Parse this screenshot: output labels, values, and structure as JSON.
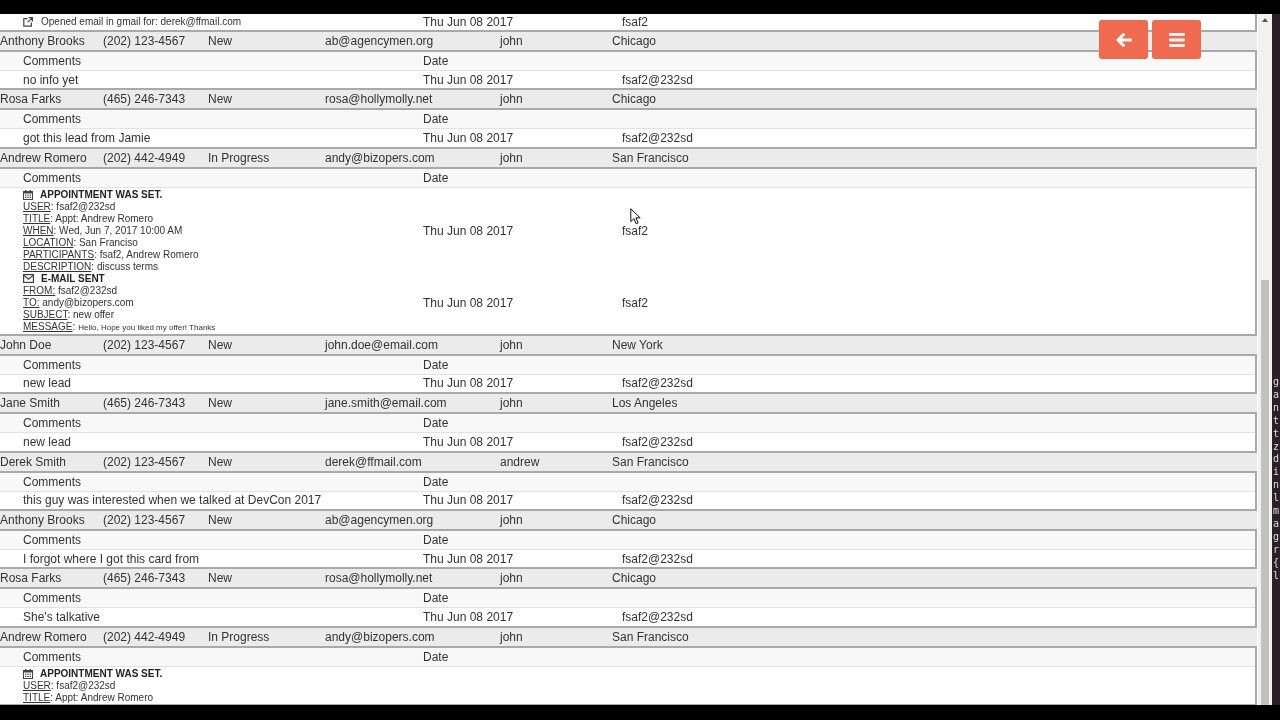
{
  "previous_lead_entries": [
    {
      "kind": "activity",
      "text": "Opened email in gmail for: derek@ffmail.com",
      "date": "Thu Jun 08 2017",
      "user": "fsaf2"
    }
  ],
  "leads": [
    {
      "name": "Anthony Brooks",
      "phone": "(202) 123-4567",
      "status": "New",
      "email": "ab@agencymen.org",
      "owner": "john",
      "city": "Chicago",
      "comments_header": "Comments",
      "date_header": "Date",
      "entries": [
        {
          "kind": "note",
          "text": "no info yet",
          "date": "Thu Jun 08 2017",
          "user": "fsaf2@232sd"
        }
      ]
    },
    {
      "name": "Rosa Farks",
      "phone": "(465) 246-7343",
      "status": "New",
      "email": "rosa@hollymolly.net",
      "owner": "john",
      "city": "Chicago",
      "comments_header": "Comments",
      "date_header": "Date",
      "entries": [
        {
          "kind": "note",
          "text": "got this lead from Jamie",
          "date": "Thu Jun 08 2017",
          "user": "fsaf2@232sd"
        }
      ]
    },
    {
      "name": "Andrew Romero",
      "phone": "(202) 442-4949",
      "status": "In Progress",
      "email": "andy@bizopers.com",
      "owner": "john",
      "city": "San Francisco",
      "comments_header": "Comments",
      "date_header": "Date",
      "entries": [
        {
          "kind": "appointment",
          "title": "APPOINTMENT WAS SET.",
          "fields": [
            {
              "label": "USER",
              "value": ": fsaf2@232sd"
            },
            {
              "label": "TITLE",
              "value": ": Appt: Andrew Romero"
            },
            {
              "label": "WHEN",
              "value": ": Wed, Jun 7, 2017 10:00 AM"
            },
            {
              "label": "LOCATION",
              "value": ": San Franciso"
            },
            {
              "label": "PARTICIPANTS",
              "value": ": fsaf2, Andrew Romero"
            },
            {
              "label": "DESCRIPTION",
              "value": ": discuss terms"
            }
          ],
          "date": "Thu Jun 08 2017",
          "user": "fsaf2"
        },
        {
          "kind": "email",
          "title": "E-MAIL SENT",
          "fields": [
            {
              "label": "FROM:",
              "value": " fsaf2@232sd"
            },
            {
              "label": "TO:",
              "value": " andy@bizopers.com"
            },
            {
              "label": "SUBJECT",
              "value": ": new offer"
            },
            {
              "label": "MESSAGE",
              "value": ":",
              "fine_print": "Hello, Hope you liked my offer! Thanks"
            }
          ],
          "date": "Thu Jun 08 2017",
          "user": "fsaf2"
        }
      ]
    },
    {
      "name": "John Doe",
      "phone": "(202) 123-4567",
      "status": "New",
      "email": "john.doe@email.com",
      "owner": "john",
      "city": "New York",
      "comments_header": "Comments",
      "date_header": "Date",
      "entries": [
        {
          "kind": "note",
          "text": "new lead",
          "date": "Thu Jun 08 2017",
          "user": "fsaf2@232sd"
        }
      ]
    },
    {
      "name": "Jane Smith",
      "phone": "(465) 246-7343",
      "status": "New",
      "email": "jane.smith@email.com",
      "owner": "john",
      "city": "Los Angeles",
      "comments_header": "Comments",
      "date_header": "Date",
      "entries": [
        {
          "kind": "note",
          "text": "new lead",
          "date": "Thu Jun 08 2017",
          "user": "fsaf2@232sd"
        }
      ]
    },
    {
      "name": "Derek Smith",
      "phone": "(202) 123-4567",
      "status": "New",
      "email": "derek@ffmail.com",
      "owner": "andrew",
      "city": "San Francisco",
      "comments_header": "Comments",
      "date_header": "Date",
      "entries": [
        {
          "kind": "note",
          "text": "this guy was interested when we talked at DevCon 2017",
          "date": "Thu Jun 08 2017",
          "user": "fsaf2@232sd"
        }
      ]
    },
    {
      "name": "Anthony Brooks",
      "phone": "(202) 123-4567",
      "status": "New",
      "email": "ab@agencymen.org",
      "owner": "john",
      "city": "Chicago",
      "comments_header": "Comments",
      "date_header": "Date",
      "entries": [
        {
          "kind": "note",
          "text": "I forgot where I got this card from",
          "date": "Thu Jun 08 2017",
          "user": "fsaf2@232sd"
        }
      ]
    },
    {
      "name": "Rosa Farks",
      "phone": "(465) 246-7343",
      "status": "New",
      "email": "rosa@hollymolly.net",
      "owner": "john",
      "city": "Chicago",
      "comments_header": "Comments",
      "date_header": "Date",
      "entries": [
        {
          "kind": "note",
          "text": "She's talkative",
          "date": "Thu Jun 08 2017",
          "user": "fsaf2@232sd"
        }
      ]
    },
    {
      "name": "Andrew Romero",
      "phone": "(202) 442-4949",
      "status": "In Progress",
      "email": "andy@bizopers.com",
      "owner": "john",
      "city": "San Francisco",
      "comments_header": "Comments",
      "date_header": "Date",
      "entries": [
        {
          "kind": "appointment",
          "title": "APPOINTMENT WAS SET.",
          "fields": [
            {
              "label": "USER",
              "value": ": fsaf2@232sd"
            },
            {
              "label": "TITLE",
              "value": ": Appt: Andrew Romero"
            }
          ]
        }
      ]
    }
  ],
  "background_window": {
    "lines": [
      "g",
      "a",
      "n",
      "t",
      "t",
      "z",
      "d",
      "i",
      "n",
      "l",
      "m",
      "a",
      "g",
      "r",
      "{",
      "l"
    ]
  }
}
